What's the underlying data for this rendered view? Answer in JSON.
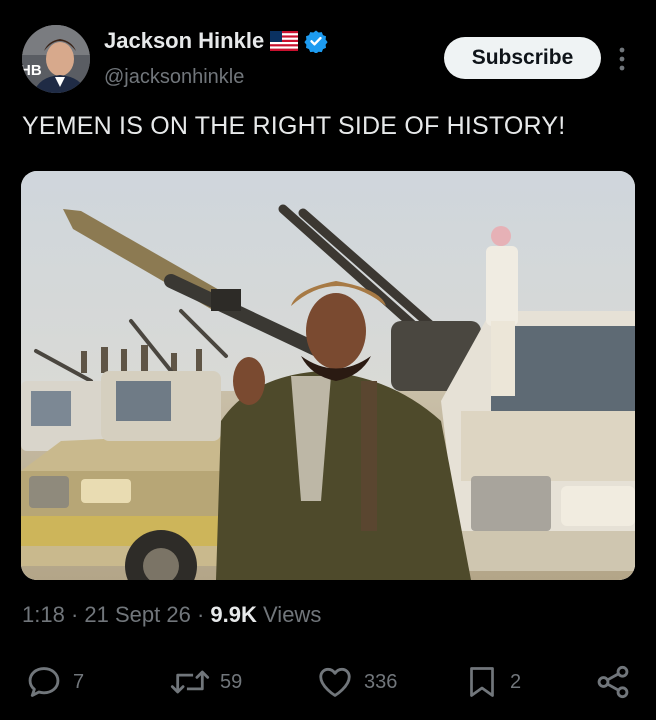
{
  "author": {
    "name": "Jackson Hinkle",
    "handle": "@jacksonhinkle",
    "flag_icon": "us-flag-icon",
    "verified_color": "#1d9bf0",
    "avatar_letters": "HB"
  },
  "subscribe_label": "Subscribe",
  "tweet": {
    "text": "YEMEN IS ON THE RIGHT SIDE OF HISTORY!"
  },
  "meta": {
    "time": "1:18",
    "sep1": "·",
    "date": "21 Sept 26",
    "sep2": "·",
    "views_count": "9.9K",
    "views_label": "Views"
  },
  "actions": {
    "replies": "7",
    "reposts": "59",
    "likes": "336",
    "bookmarks": "2"
  },
  "colors": {
    "background": "#000000",
    "text": "#e7e9ea",
    "secondary_text": "#71767b",
    "subscribe_bg": "#eff3f4"
  }
}
